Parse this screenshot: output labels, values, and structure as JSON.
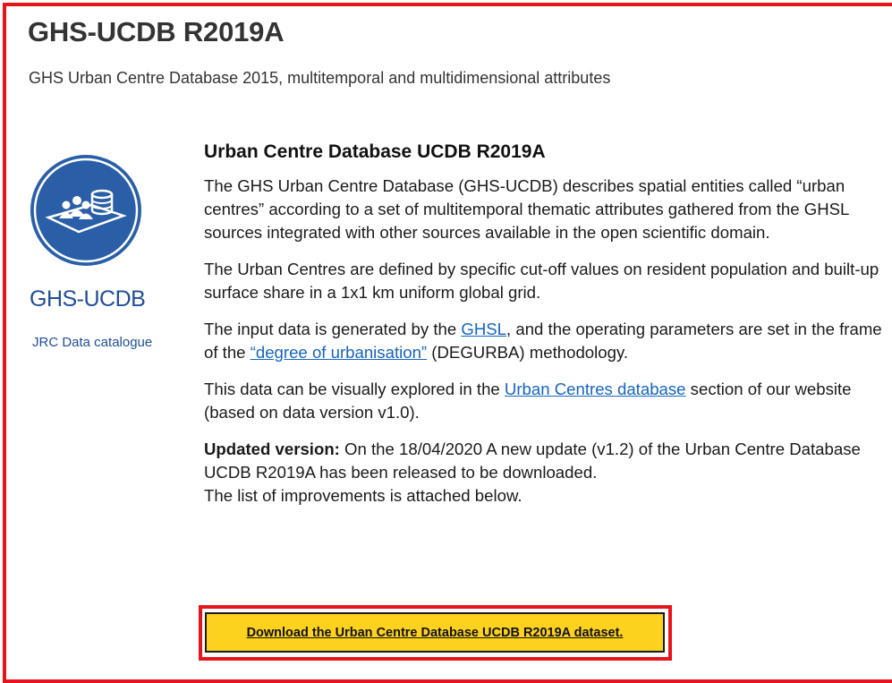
{
  "header": {
    "title": "GHS-UCDB R2019A",
    "subtitle": "GHS Urban Centre Database 2015, multitemporal and multidimensional attributes"
  },
  "sidebar": {
    "logo_name": "GHS-UCDB",
    "catalogue_link": "JRC Data catalogue"
  },
  "main": {
    "section_title": "Urban Centre Database UCDB R2019A",
    "p1": "The GHS Urban Centre Database (GHS-UCDB) describes spatial entities called “urban centres” according to a set of multitemporal thematic attributes gathered from the GHSL sources integrated with other sources available in the open scientific domain.",
    "p2": "The Urban Centres are defined by specific cut-off values on resident population and built-up surface share in a 1x1 km uniform global grid.",
    "p3": {
      "before": "The input data is generated by the ",
      "link1": "GHSL",
      "middle": ", and the operating parameters are set in the frame of the ",
      "link2": "“degree of urbanisation”",
      "after": " (DEGURBA) methodology."
    },
    "p4": {
      "before": "This data can be visually explored in the ",
      "link": "Urban Centres database",
      "after": " section of our website (based on data version v1.0)."
    },
    "p5": {
      "label": "Updated version:",
      "text": " On the 18/04/2020 A new update (v1.2) of the Urban Centre Database UCDB R2019A has been released to be downloaded.",
      "line2": "The list of improvements is attached below."
    },
    "download_label": "Download the Urban Centre Database UCDB R2019A dataset."
  },
  "colors": {
    "highlight": "#e8141b",
    "link": "#1565c0",
    "logo_blue": "#1f4e9a",
    "button": "#fcd21e"
  }
}
